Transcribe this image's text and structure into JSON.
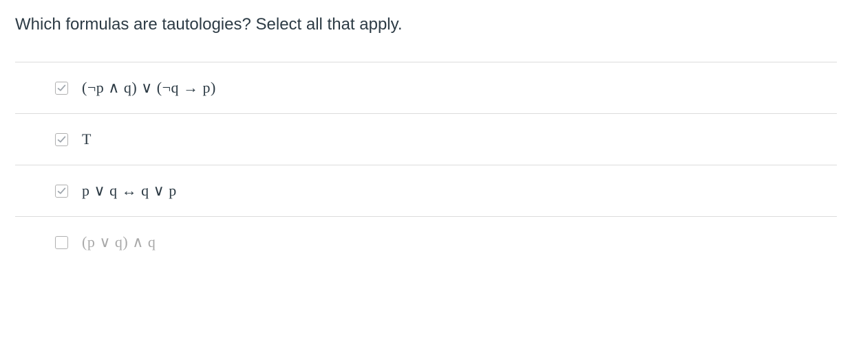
{
  "question": "Which formulas are tautologies? Select all that apply.",
  "options": [
    {
      "label": "(¬p ∧ q) ∨ (¬q → p)",
      "checked": true,
      "dim": false
    },
    {
      "label": "T",
      "checked": true,
      "dim": false
    },
    {
      "label": "p ∨ q ↔ q ∨ p",
      "checked": true,
      "dim": false
    },
    {
      "label": "(p ∨ q) ∧ q",
      "checked": false,
      "dim": true
    }
  ]
}
